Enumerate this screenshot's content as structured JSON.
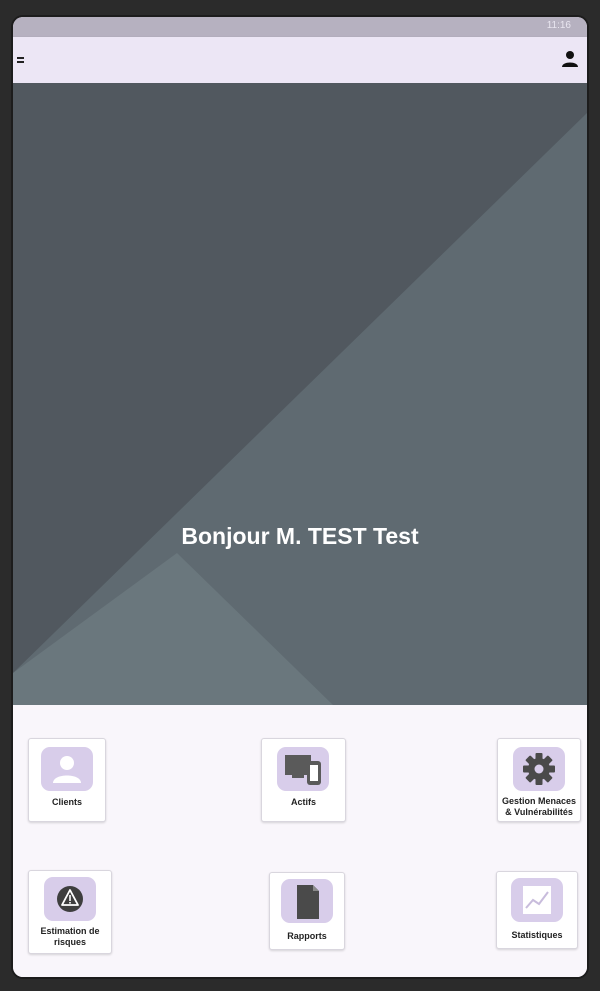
{
  "status_bar": {
    "time": "11:16"
  },
  "app_bar": {
    "menu_icon": "menu-icon",
    "profile_icon": "account-icon"
  },
  "hero": {
    "greeting": "Bonjour M. TEST Test"
  },
  "tiles": [
    {
      "label": "Clients",
      "icon": "person-icon"
    },
    {
      "label": "Actifs",
      "icon": "devices-icon"
    },
    {
      "label_line1": "Gestion Menaces",
      "label_line2": "& Vulnérabilités",
      "icon": "gear-icon"
    },
    {
      "label_line1": "Estimation de",
      "label_line2": "risques",
      "icon": "warning-icon"
    },
    {
      "label": "Rapports",
      "icon": "document-icon"
    },
    {
      "label": "Statistiques",
      "icon": "chart-icon"
    }
  ],
  "colors": {
    "app_bar": "#ece6f5",
    "hero": "#51585f",
    "icon_bg": "#d8cdea",
    "icon_fg": "#ffffff"
  }
}
